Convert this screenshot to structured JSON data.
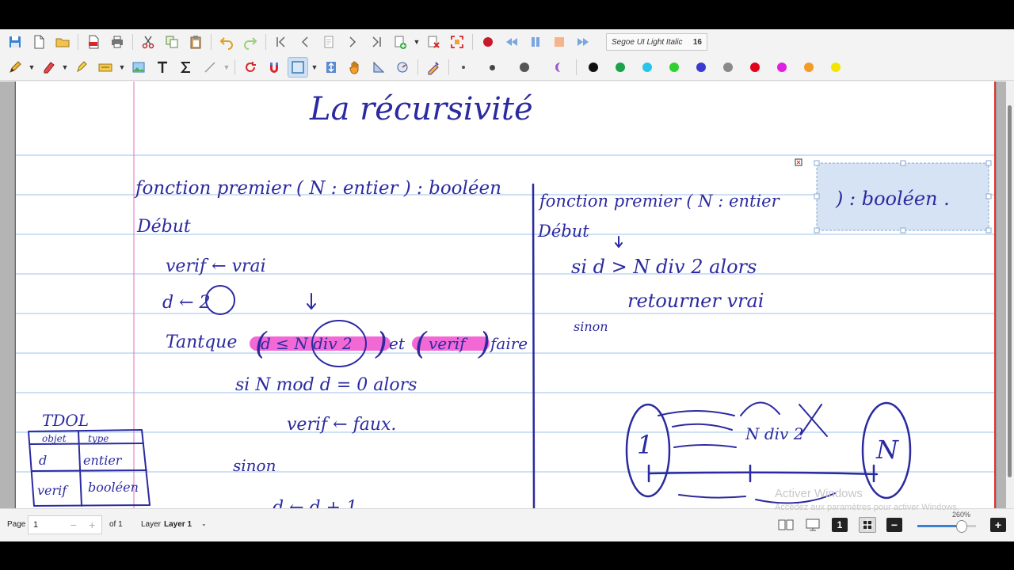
{
  "toolbar": {
    "font_name": "Segoe UI Light Italic",
    "font_size": "16",
    "colors": [
      "#111111",
      "#1aa34a",
      "#27c5e8",
      "#2ed12e",
      "#3a3ad0",
      "#8a8a8a",
      "#e3001b",
      "#e020e0",
      "#f59a23",
      "#f2e600"
    ],
    "dots_gray": [
      "#555555",
      "#444444",
      "#555555"
    ],
    "purple_tool": "#9b59d0"
  },
  "document": {
    "title": "La récursivité",
    "left": {
      "header": "fonction premier ( N : entier ) : booléen",
      "debut": "Début",
      "l1": "verif ← vrai",
      "l2": "d ← 2",
      "l3a": "Tantque",
      "l3b": "d ≤ N div 2",
      "l3c": "et",
      "l3d": "verif",
      "l3e": "faire",
      "l4": "si N mod d = 0 alors",
      "l5": "verif ← faux.",
      "l6": "sinon",
      "l7": "d ← d + 1"
    },
    "tdol": {
      "title": "TDOL",
      "headers": [
        "objet",
        "type"
      ],
      "rows": [
        [
          "d",
          "entier"
        ],
        [
          "verif",
          "booléen"
        ]
      ]
    },
    "right": {
      "header": "fonction premier ( N : entier",
      "selected": ") : booléen .",
      "debut": "Début",
      "l1": "si d > N div 2 alors",
      "l2": "retourner vrai",
      "l3": "sinon",
      "diagram_left": "1",
      "diagram_mid": "N div 2",
      "diagram_right": "N"
    }
  },
  "status": {
    "page_label": "Page",
    "page_value": "1",
    "page_of": "of 1",
    "layer_label": "Layer",
    "layer_value": "Layer 1",
    "zoom": "260%",
    "watermark_title": "Activer Windows",
    "watermark_sub": "Accédez aux paramètres pour activer Windows."
  }
}
